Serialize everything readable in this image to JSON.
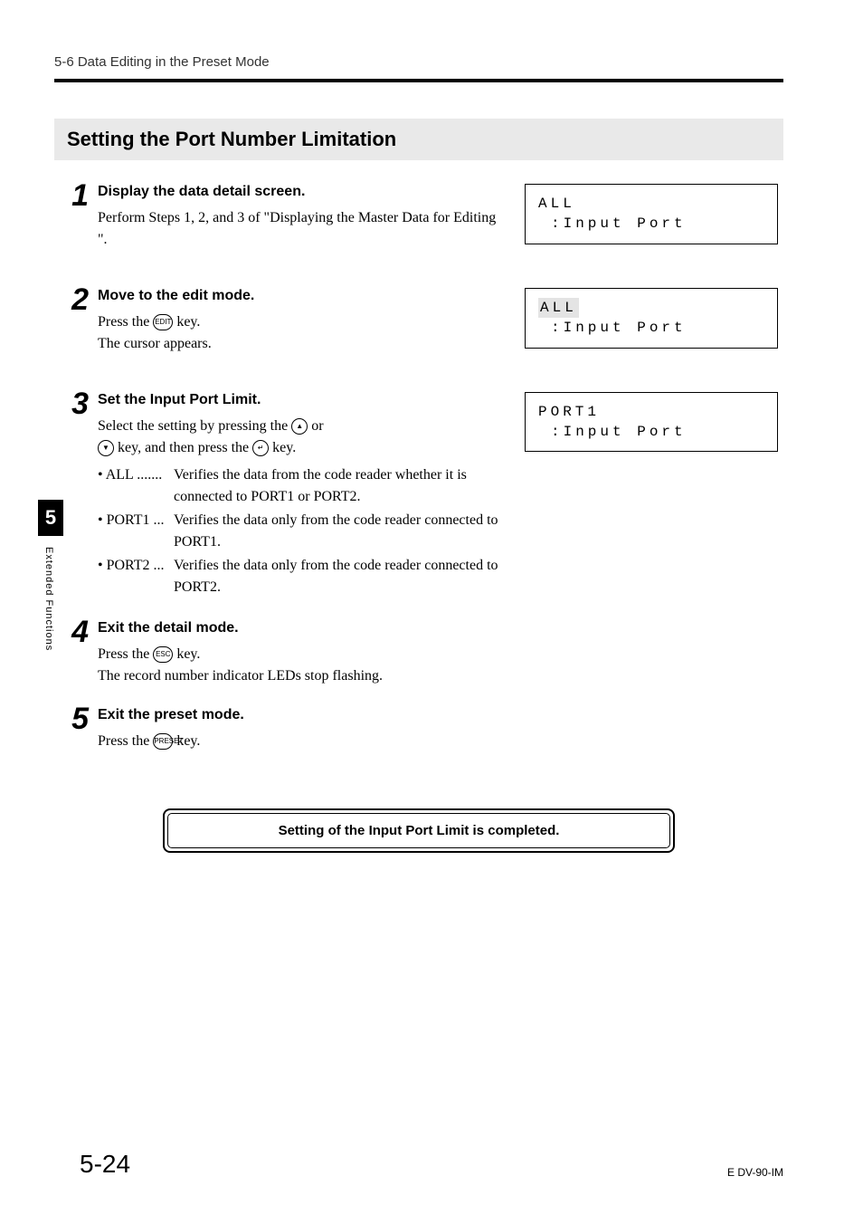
{
  "header": {
    "section_path": "5-6  Data Editing in the Preset Mode"
  },
  "section_title": "Setting the Port Number Limitation",
  "steps": [
    {
      "num": "1",
      "title": "Display the data detail screen.",
      "body": "Perform Steps 1, 2, and 3 of \"Displaying the Master Data for Editing \".",
      "display": {
        "line1": "ALL",
        "line2": ":Input Port",
        "highlight": false
      }
    },
    {
      "num": "2",
      "title": "Move to the edit mode.",
      "pre_key": "Press the ",
      "key_label": "EDIT",
      "post_key": " key.",
      "extra": "The cursor appears.",
      "display": {
        "line1": "ALL",
        "line2": ":Input Port",
        "highlight": true
      }
    },
    {
      "num": "3",
      "title": "Set the Input Port Limit.",
      "select_pre": "Select the setting by pressing the ",
      "key_up": "▲",
      "select_mid": " or ",
      "key_down": "▼",
      "select_mid2": " key, and then press the ",
      "key_enter": "↵",
      "select_post": " key.",
      "bullets": [
        {
          "label": "• ALL",
          "dots": ".......",
          "desc": "Verifies the data from the code reader whether it is connected to PORT1 or PORT2."
        },
        {
          "label": "• PORT1",
          "dots": "...",
          "desc": "Verifies the data only from the code reader connected to PORT1."
        },
        {
          "label": "• PORT2",
          "dots": "...",
          "desc": "Verifies the data only from the code reader connected to PORT2."
        }
      ],
      "display": {
        "line1": "PORT1",
        "line2": ":Input Port",
        "highlight": false
      }
    },
    {
      "num": "4",
      "title": "Exit the detail mode.",
      "pre_key": "Press the ",
      "key_label": "ESC",
      "post_key": " key.",
      "extra": "The record number indicator LEDs stop flashing."
    },
    {
      "num": "5",
      "title": "Exit the preset mode.",
      "pre_key": "Press the ",
      "key_label": "PRESET",
      "post_key": " key."
    }
  ],
  "sidebar": {
    "chapter_num": "5",
    "label": "Extended Functions"
  },
  "completion": "Setting of the Input Port Limit is completed.",
  "footer": {
    "page": "5-24",
    "docid": "E DV-90-IM"
  }
}
